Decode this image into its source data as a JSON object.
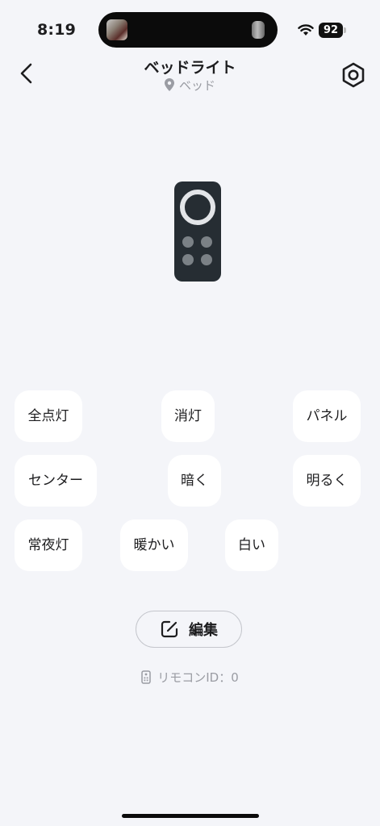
{
  "status_bar": {
    "time": "8:19",
    "battery": "92"
  },
  "header": {
    "title": "ベッドライト",
    "room": "ベッド"
  },
  "buttons": [
    {
      "name": "all-light-button",
      "label": "全点灯"
    },
    {
      "name": "off-button",
      "label": "消灯"
    },
    {
      "name": "panel-button",
      "label": "パネル"
    },
    {
      "name": "center-button",
      "label": "センター"
    },
    {
      "name": "dim-button",
      "label": "暗く"
    },
    {
      "name": "brighten-button",
      "label": "明るく"
    },
    {
      "name": "night-light-button",
      "label": "常夜灯"
    },
    {
      "name": "warm-button",
      "label": "暖かい"
    },
    {
      "name": "white-button",
      "label": "白い"
    }
  ],
  "edit": {
    "label": "編集"
  },
  "remote_info": {
    "label": "リモコンID：0"
  },
  "icons": {
    "back": "chevron-left-icon",
    "settings": "hexagon-gear-icon",
    "location": "location-pin-icon",
    "edit": "edit-square-icon",
    "remote": "remote-control-icon"
  },
  "colors": {
    "background": "#f4f5f9",
    "remote_body": "#262d33",
    "button_bg": "#ffffff",
    "secondary_text": "#9a9ca3"
  }
}
